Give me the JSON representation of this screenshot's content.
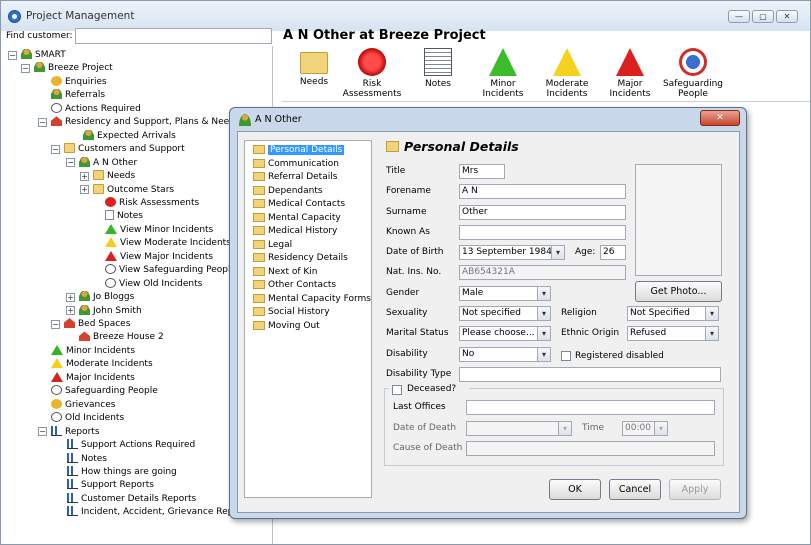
{
  "app": {
    "title": "Project Management"
  },
  "window_controls": {
    "minimize": "—",
    "maximize": "▢",
    "close": "✕"
  },
  "find": {
    "label": "Find customer:",
    "value": ""
  },
  "tree": [
    {
      "label": "SMART",
      "icon": "people-group-icon",
      "expander": "−"
    },
    {
      "label": "Breeze Project",
      "icon": "project-icon",
      "expander": "−"
    },
    {
      "label": "Enquiries",
      "icon": "question-icon"
    },
    {
      "label": "Referrals",
      "icon": "people-icon"
    },
    {
      "label": "Actions Required",
      "icon": "actions-icon"
    },
    {
      "label": "Residency and Support, Plans & Needs",
      "icon": "house-icon",
      "expander": "−"
    },
    {
      "label": "Expected Arrivals",
      "icon": "person-icon"
    },
    {
      "label": "Customers and Support",
      "icon": "folder-icon",
      "expander": "−"
    },
    {
      "label": "A N Other",
      "icon": "person-icon",
      "expander": "−"
    },
    {
      "label": "Needs",
      "icon": "folder-icon",
      "expander": "+"
    },
    {
      "label": "Outcome Stars",
      "icon": "folder-icon",
      "expander": "+"
    },
    {
      "label": "Risk Assessments",
      "icon": "risk-icon"
    },
    {
      "label": "Notes",
      "icon": "notes-icon"
    },
    {
      "label": "View Minor Incidents",
      "icon": "minor-incident-icon"
    },
    {
      "label": "View Moderate Incidents",
      "icon": "moderate-incident-icon"
    },
    {
      "label": "View Major Incidents",
      "icon": "major-incident-icon"
    },
    {
      "label": "View Safeguarding People",
      "icon": "safeguarding-icon"
    },
    {
      "label": "View Old Incidents",
      "icon": "old-incidents-icon"
    },
    {
      "label": "Jo Bloggs",
      "icon": "person-icon",
      "expander": "+"
    },
    {
      "label": "John Smith",
      "icon": "person-icon",
      "expander": "+"
    },
    {
      "label": "Bed Spaces",
      "icon": "bed-icon",
      "expander": "−"
    },
    {
      "label": "Breeze House 2",
      "icon": "house-icon"
    },
    {
      "label": "Minor Incidents",
      "icon": "minor-incident-icon"
    },
    {
      "label": "Moderate Incidents",
      "icon": "moderate-incident-icon"
    },
    {
      "label": "Major Incidents",
      "icon": "major-incident-icon"
    },
    {
      "label": "Safeguarding People",
      "icon": "safeguarding-icon"
    },
    {
      "label": "Grievances",
      "icon": "grievance-icon"
    },
    {
      "label": "Old Incidents",
      "icon": "old-incidents-icon"
    },
    {
      "label": "Reports",
      "icon": "chart-icon",
      "expander": "−"
    },
    {
      "label": "Support Actions Required",
      "icon": "chart-icon"
    },
    {
      "label": "Notes",
      "icon": "chart-icon"
    },
    {
      "label": "How things are going",
      "icon": "chart-icon"
    },
    {
      "label": "Support Reports",
      "icon": "chart-icon"
    },
    {
      "label": "Customer Details Reports",
      "icon": "chart-icon"
    },
    {
      "label": "Incident, Accident, Grievance Repo",
      "icon": "chart-icon"
    }
  ],
  "header": {
    "title": "A N Other at Breeze Project"
  },
  "toolbar": [
    {
      "label": "Needs",
      "icon": "folder-icon"
    },
    {
      "label": "Risk\nAssessments",
      "icon": "risk-icon"
    },
    {
      "label": "Notes",
      "icon": "notes-icon"
    },
    {
      "label": "Minor\nIncidents",
      "icon": "minor-incident-icon"
    },
    {
      "label": "Moderate\nIncidents",
      "icon": "moderate-incident-icon"
    },
    {
      "label": "Major\nIncidents",
      "icon": "major-incident-icon"
    },
    {
      "label": "Safeguarding\nPeople",
      "icon": "safeguarding-icon"
    }
  ],
  "dialog": {
    "title": "A N Other",
    "close": "✕",
    "nav": [
      "Personal Details",
      "Communication",
      "Referral Details",
      "Dependants",
      "Medical Contacts",
      "Mental Capacity",
      "Medical History",
      "Legal",
      "Residency Details",
      "Next of Kin",
      "Other Contacts",
      "Mental Capacity Forms",
      "Social History",
      "Moving Out"
    ],
    "section_title": "Personal Details",
    "labels": {
      "title": "Title",
      "forename": "Forename",
      "surname": "Surname",
      "known_as": "Known As",
      "dob": "Date of Birth",
      "age": "Age:",
      "ni": "Nat. Ins. No.",
      "gender": "Gender",
      "sexuality": "Sexuality",
      "religion": "Religion",
      "marital": "Marital Status",
      "ethnic": "Ethnic Origin",
      "disability": "Disability",
      "registered": "Registered disabled",
      "disability_type": "Disability Type",
      "deceased": "Deceased?",
      "last_offices": "Last Offices",
      "date_of_death": "Date of Death",
      "time": "Time",
      "cause_of_death": "Cause of Death"
    },
    "values": {
      "title": "Mrs",
      "forename": "A N",
      "surname": "Other",
      "known_as": "",
      "dob": "13 September 1984",
      "age": "26",
      "ni": "AB654321A",
      "gender": "Male",
      "sexuality": "Not specified",
      "religion": "Not Specified",
      "marital": "Please choose...",
      "ethnic": "Refused",
      "disability": "No",
      "disability_type": "",
      "last_offices": "",
      "date_of_death": "",
      "time": "00:00",
      "cause_of_death": ""
    },
    "registered_checked": false,
    "deceased_checked": false,
    "buttons": {
      "get_photo": "Get Photo...",
      "ok": "OK",
      "cancel": "Cancel",
      "apply": "Apply"
    }
  }
}
